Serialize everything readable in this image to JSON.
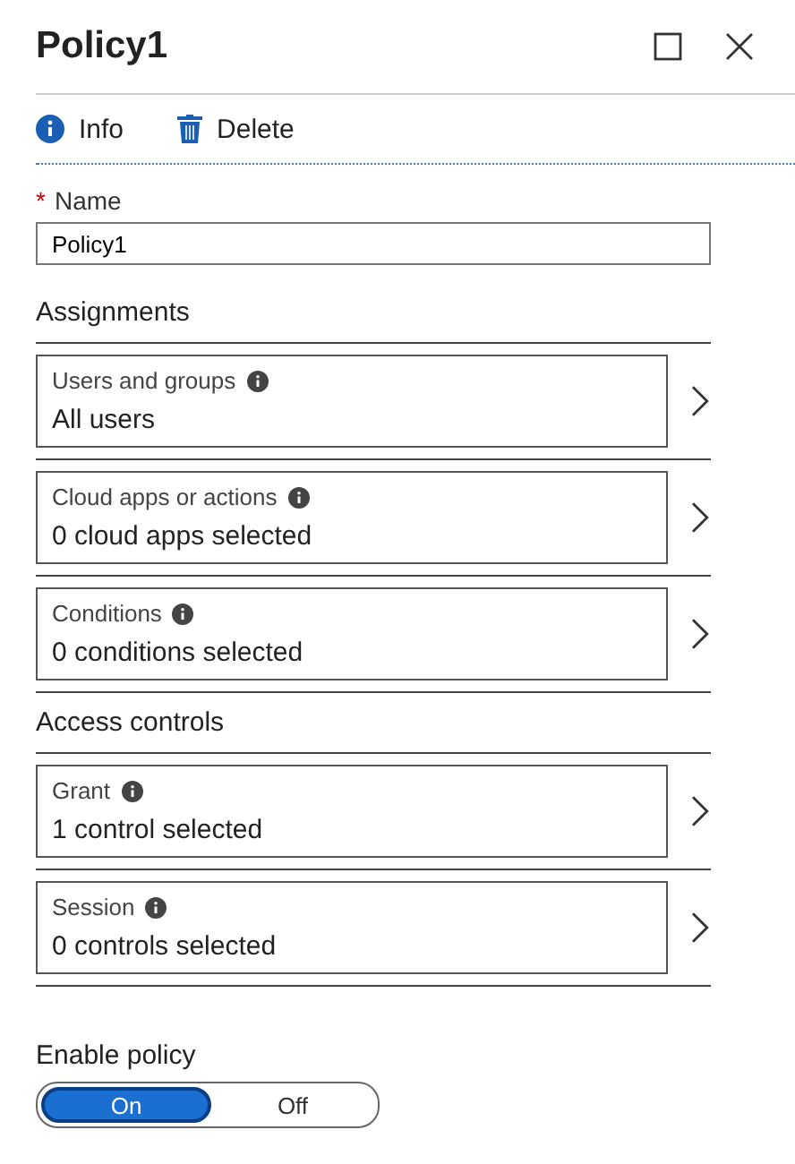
{
  "window": {
    "title": "Policy1"
  },
  "toolbar": [
    {
      "kind": "info",
      "label": "Info"
    },
    {
      "kind": "delete",
      "label": "Delete"
    }
  ],
  "name_field": {
    "required_mark": "*",
    "label": "Name",
    "value": "Policy1"
  },
  "sections": [
    {
      "title": "Assignments",
      "items": [
        {
          "label": "Users and groups",
          "value": "All users"
        },
        {
          "label": "Cloud apps or actions",
          "value": "0 cloud apps selected"
        },
        {
          "label": "Conditions",
          "value": "0 conditions selected"
        }
      ]
    },
    {
      "title": "Access controls",
      "items": [
        {
          "label": "Grant",
          "value": "1 control selected"
        },
        {
          "label": "Session",
          "value": "0 controls selected"
        }
      ]
    }
  ],
  "enable_policy": {
    "label": "Enable policy",
    "options": [
      {
        "label": "On",
        "selected": true
      },
      {
        "label": "Off",
        "selected": false
      }
    ]
  }
}
